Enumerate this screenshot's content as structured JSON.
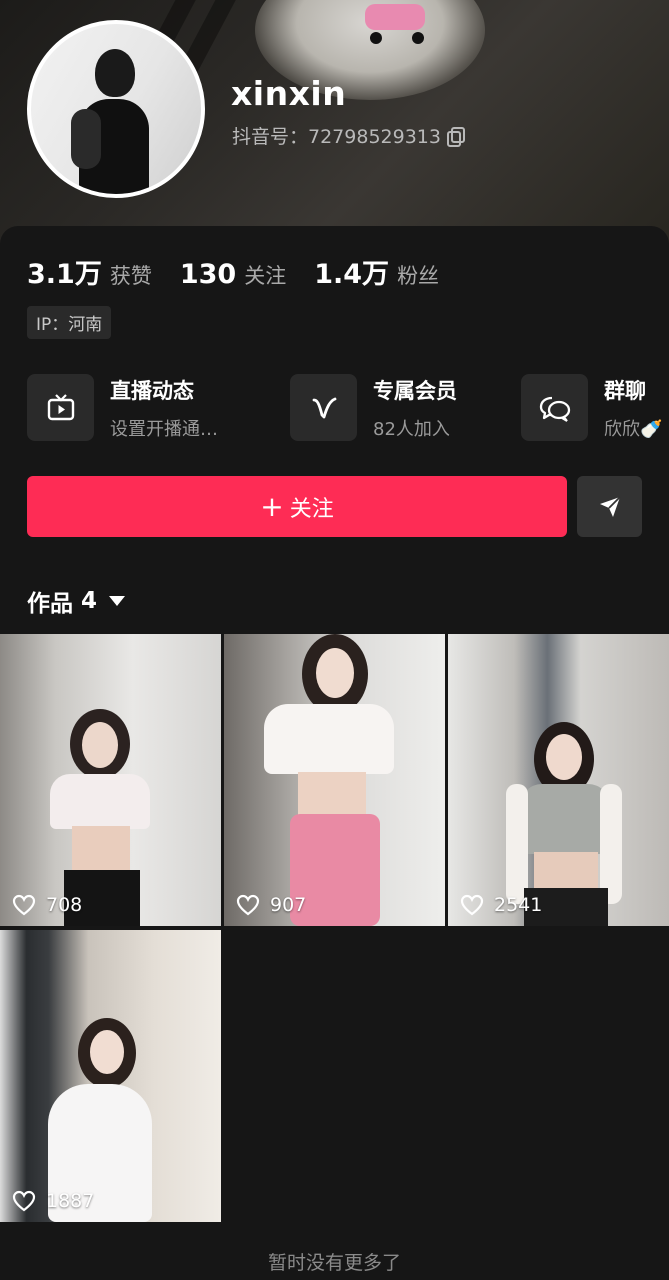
{
  "profile": {
    "username": "xinxin",
    "douyin_id": "抖音号：72798529313"
  },
  "stats": [
    {
      "value": "3.1万",
      "label": "获赞"
    },
    {
      "value": "130",
      "label": "关注"
    },
    {
      "value": "1.4万",
      "label": "粉丝"
    }
  ],
  "ip_location": "IP：河南",
  "features": [
    {
      "title": "直播动态",
      "subtitle": "设置开播通…",
      "icon": "tv-icon"
    },
    {
      "title": "专属会员",
      "subtitle": "82人加入",
      "icon": "v-icon"
    },
    {
      "title": "群聊",
      "subtitle": "欣欣🍼",
      "icon": "chat-bubbles-icon"
    }
  ],
  "actions": {
    "follow_label": "关注",
    "follow_prefix": "+",
    "share_icon": "send-icon"
  },
  "works_tab": {
    "label": "作品",
    "count": "4"
  },
  "videos": [
    {
      "likes": "708"
    },
    {
      "likes": "907"
    },
    {
      "likes": "2541"
    },
    {
      "likes": "1887"
    }
  ],
  "footer": "暂时没有更多了",
  "colors": {
    "accent": "#fe2c55",
    "background": "#161616"
  }
}
